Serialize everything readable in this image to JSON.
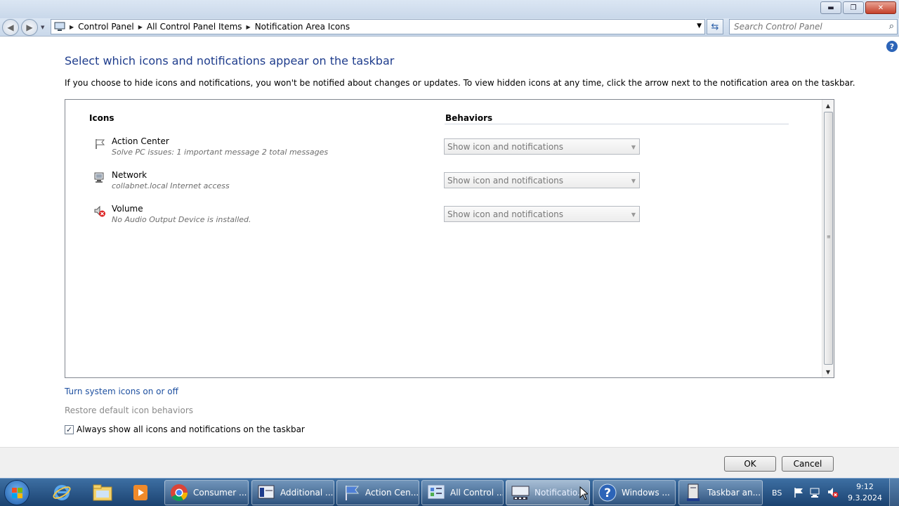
{
  "window": {
    "controls": {
      "minimize": "▬",
      "maximize": "❐",
      "close": "✕"
    }
  },
  "address_bar": {
    "breadcrumbs": [
      "Control Panel",
      "All Control Panel Items",
      "Notification Area Icons"
    ],
    "search_placeholder": "Search Control Panel"
  },
  "page": {
    "heading": "Select which icons and notifications appear on the taskbar",
    "intro": "If you choose to hide icons and notifications, you won't be notified about changes or updates. To view hidden icons at any time, click the arrow next to the notification area on the taskbar."
  },
  "table": {
    "col_icons": "Icons",
    "col_behaviors": "Behaviors",
    "rows": [
      {
        "icon": "action-center-flag-icon",
        "name": "Action Center",
        "description": "Solve PC issues: 1 important message  2 total messages",
        "behavior": "Show icon and notifications"
      },
      {
        "icon": "network-icon",
        "name": "Network",
        "description": "collabnet.local Internet access",
        "behavior": "Show icon and notifications"
      },
      {
        "icon": "volume-muted-icon",
        "name": "Volume",
        "description": "No Audio Output Device is installed.",
        "behavior": "Show icon and notifications"
      }
    ]
  },
  "links": {
    "system_icons": "Turn system icons on or off",
    "restore_defaults": "Restore default icon behaviors"
  },
  "always_show": {
    "label": "Always show all icons and notifications on the taskbar",
    "checked": true
  },
  "footer": {
    "ok": "OK",
    "cancel": "Cancel"
  },
  "taskbar": {
    "items": [
      {
        "label": "Consumer ...",
        "icon": "chrome-icon"
      },
      {
        "label": "Additional ...",
        "icon": "program-window-icon"
      },
      {
        "label": "Action Cen...",
        "icon": "action-center-flag-icon"
      },
      {
        "label": "All Control ...",
        "icon": "control-panel-icon"
      },
      {
        "label": "Notificatio...",
        "icon": "notification-area-icon"
      },
      {
        "label": "Windows ...",
        "icon": "help-icon"
      },
      {
        "label": "Taskbar an...",
        "icon": "taskbar-properties-icon"
      }
    ],
    "language": "BS",
    "time": "9:12",
    "date": "9.3.2024"
  },
  "colors": {
    "heading": "#1e3c8c",
    "link": "#1e50a0",
    "taskbar": "#1b4270"
  }
}
